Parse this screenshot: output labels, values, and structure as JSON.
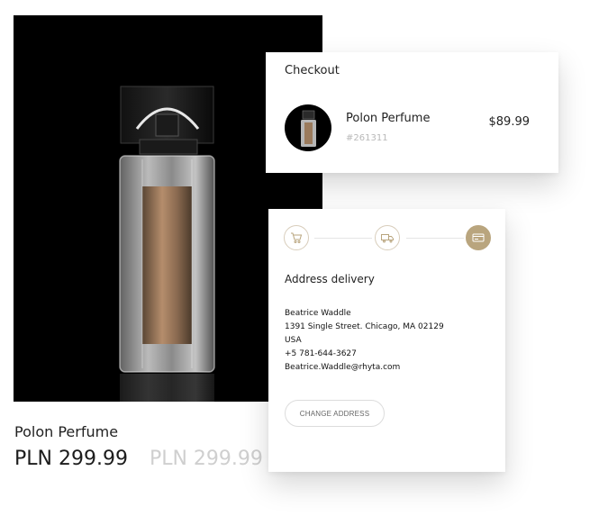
{
  "product": {
    "name": "Polon Perfume",
    "price": "PLN 299.99",
    "old_price": "PLN 299.99"
  },
  "checkout": {
    "title": "Checkout",
    "item": {
      "name": "Polon Perfume",
      "sku": "#261311",
      "price": "$89.99"
    }
  },
  "delivery": {
    "steps": [
      {
        "icon": "cart-icon",
        "active": false
      },
      {
        "icon": "truck-icon",
        "active": false
      },
      {
        "icon": "card-icon",
        "active": true
      }
    ],
    "title": "Address delivery",
    "address": {
      "name": "Beatrice Waddle",
      "street": "1391 Single Street. Chicago, MA 02129",
      "country": "USA",
      "phone": "+5 781-644-3627",
      "email": "Beatrice.Waddle@rhyta.com"
    },
    "change_button": "CHANGE ADDRESS"
  },
  "colors": {
    "accent": "#b9a57e",
    "photo_bg": "#000000"
  }
}
